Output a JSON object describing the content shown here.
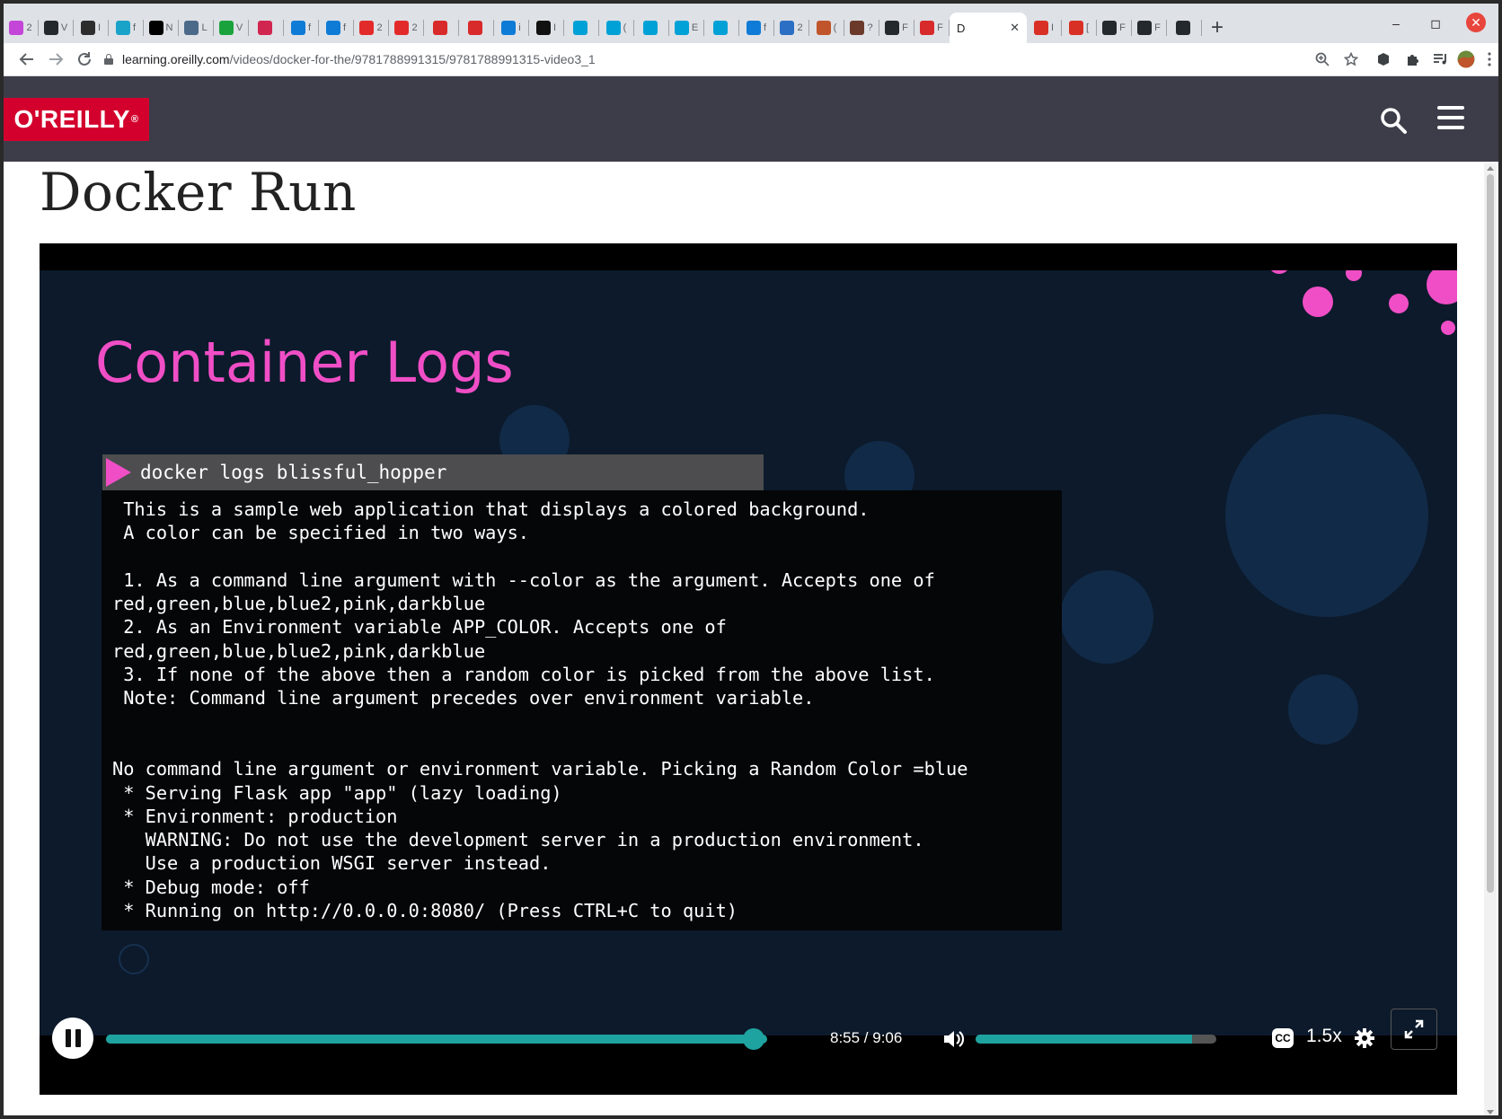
{
  "browser": {
    "tabs": [
      {
        "fav": "#c346d8",
        "label": "2"
      },
      {
        "fav": "#24292e",
        "label": "V"
      },
      {
        "fav": "#2d2d2d",
        "label": "I"
      },
      {
        "fav": "#1aa3c8",
        "label": "f"
      },
      {
        "fav": "#000000",
        "label": "N"
      },
      {
        "fav": "#4b6a8a",
        "label": "L"
      },
      {
        "fav": "#1aa33c",
        "label": "V"
      },
      {
        "fav": "#d1264f",
        "label": ""
      },
      {
        "fav": "#0e7bd6",
        "label": "f"
      },
      {
        "fav": "#0e7bd6",
        "label": "f"
      },
      {
        "fav": "#e32a2a",
        "label": "2"
      },
      {
        "fav": "#e32a2a",
        "label": "2"
      },
      {
        "fav": "#d82a2a",
        "label": ""
      },
      {
        "fav": "#d82a2a",
        "label": ""
      },
      {
        "fav": "#0e7bd6",
        "label": "i"
      },
      {
        "fav": "#111111",
        "label": "I"
      },
      {
        "fav": "#00a1d6",
        "label": ""
      },
      {
        "fav": "#00a1d6",
        "label": "("
      },
      {
        "fav": "#00a1d6",
        "label": ""
      },
      {
        "fav": "#00a1d6",
        "label": "E"
      },
      {
        "fav": "#00a1d6",
        "label": ""
      },
      {
        "fav": "#0e7bd6",
        "label": "f"
      },
      {
        "fav": "#2b6fc4",
        "label": "2"
      },
      {
        "fav": "#c0552b",
        "label": "("
      },
      {
        "fav": "#6b3a2a",
        "label": "?"
      },
      {
        "fav": "#24292e",
        "label": "F"
      },
      {
        "fav": "#d82a2a",
        "label": "F"
      }
    ],
    "active_tab": {
      "label": "D",
      "close": "✕"
    },
    "tabs_after": [
      {
        "fav": "#d93025",
        "label": "I"
      },
      {
        "fav": "#d93025",
        "label": "["
      },
      {
        "fav": "#24292e",
        "label": "F"
      },
      {
        "fav": "#24292e",
        "label": "F"
      },
      {
        "fav": "#24292e",
        "label": ""
      }
    ],
    "new_tab": "+",
    "minimize": "–",
    "maximize": "◻",
    "close": "✕",
    "url_host": "learning.oreilly.com",
    "url_path": "/videos/docker-for-the/9781788991315/9781788991315-video3_1"
  },
  "site": {
    "logo": "O'REILLY",
    "logo_mark": "®"
  },
  "page": {
    "title": "Docker Run"
  },
  "slide": {
    "title": "Container Logs",
    "command": "docker logs blissful_hopper",
    "terminal": " This is a sample web application that displays a colored background.\n A color can be specified in two ways.\n\n 1. As a command line argument with --color as the argument. Accepts one of\nred,green,blue,blue2,pink,darkblue\n 2. As an Environment variable APP_COLOR. Accepts one of\nred,green,blue,blue2,pink,darkblue\n 3. If none of the above then a random color is picked from the above list.\n Note: Command line argument precedes over environment variable.\n\n\nNo command line argument or environment variable. Picking a Random Color =blue\n * Serving Flask app \"app\" (lazy loading)\n * Environment: production\n   WARNING: Do not use the development server in a production environment.\n   Use a production WSGI server instead.\n * Debug mode: off\n * Running on http://0.0.0.0:8080/ (Press CTRL+C to quit)"
  },
  "player": {
    "time": "8:55 / 9:06",
    "progress": 0.98,
    "volume": 0.9,
    "cc": "CC",
    "speed": "1.5x",
    "accent": "#1ea3a0"
  }
}
